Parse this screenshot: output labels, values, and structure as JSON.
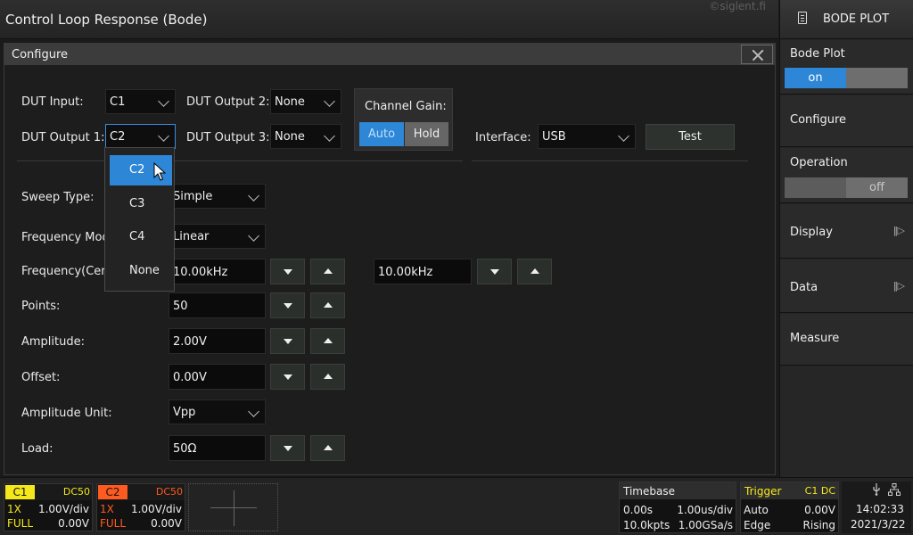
{
  "title": "Control Loop Response (Bode)",
  "watermark": "©siglent.fi",
  "right_menu": {
    "header": "BODE PLOT",
    "bode_plot": {
      "label": "Bode Plot",
      "on": "on"
    },
    "configure": "Configure",
    "operation": {
      "label": "Operation",
      "off": "off"
    },
    "display": "Display",
    "data": "Data",
    "measure": "Measure"
  },
  "dialog": {
    "title": "Configure",
    "dut_input": {
      "label": "DUT Input:",
      "value": "C1"
    },
    "dut_output1": {
      "label": "DUT Output 1:",
      "value": "C2"
    },
    "dut_output2": {
      "label": "DUT Output 2:",
      "value": "None"
    },
    "dut_output3": {
      "label": "DUT Output 3:",
      "value": "None"
    },
    "channel_gain": {
      "label": "Channel Gain:",
      "auto": "Auto",
      "hold": "Hold",
      "selected": "Auto"
    },
    "interface": {
      "label": "Interface:",
      "value": "USB"
    },
    "test_button": "Test",
    "sweep_type": {
      "label": "Sweep Type:",
      "value": "Simple"
    },
    "frequency_mode": {
      "label": "Frequency Mode:",
      "value": "Linear"
    },
    "frequency": {
      "label": "Frequency(Center):",
      "value1": "10.00kHz",
      "value2": "10.00kHz"
    },
    "points": {
      "label": "Points:",
      "value": "50"
    },
    "amplitude": {
      "label": "Amplitude:",
      "value": "2.00V"
    },
    "offset": {
      "label": "Offset:",
      "value": "0.00V"
    },
    "amplitude_unit": {
      "label": "Amplitude Unit:",
      "value": "Vpp"
    },
    "load": {
      "label": "Load:",
      "value": "50Ω"
    }
  },
  "dropdown": {
    "options": [
      "C2",
      "C3",
      "C4",
      "None"
    ],
    "selected": "C2"
  },
  "status_bar": {
    "c1": {
      "tag": "C1",
      "coupling": "DC50",
      "probe": "1X",
      "scale": "1.00V/div",
      "bw": "FULL",
      "offset": "0.00V",
      "color": "#f5e81a"
    },
    "c2": {
      "tag": "C2",
      "coupling": "DC50",
      "probe": "1X",
      "scale": "1.00V/div",
      "bw": "FULL",
      "offset": "0.00V",
      "color": "#ff5a1f"
    },
    "timebase": {
      "title": "Timebase",
      "delay": "0.00s",
      "scale": "1.00us/div",
      "points": "10.0kpts",
      "rate": "1.00GSa/s"
    },
    "trigger": {
      "title": "Trigger",
      "source": "C1 DC",
      "mode": "Auto",
      "level": "0.00V",
      "type": "Edge",
      "slope": "Rising"
    },
    "time": "14:02:33",
    "date": "2021/3/22"
  },
  "colors": {
    "accent": "#2d86d6",
    "c1": "#f5e81a",
    "c2": "#ff5a1f",
    "trigger": "#f5e81a"
  }
}
